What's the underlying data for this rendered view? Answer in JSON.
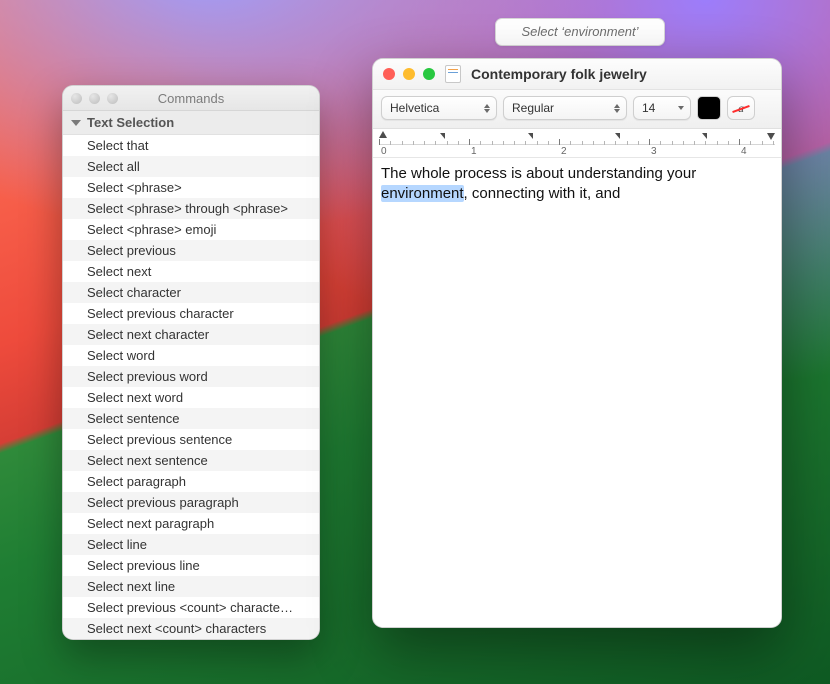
{
  "tooltip": {
    "text": "Select ‘environment’"
  },
  "commands_panel": {
    "title": "Commands",
    "section_label": "Text Selection",
    "items": [
      "Select that",
      "Select all",
      "Select <phrase>",
      "Select <phrase> through <phrase>",
      "Select <phrase> emoji",
      "Select previous",
      "Select next",
      "Select character",
      "Select previous character",
      "Select next character",
      "Select word",
      "Select previous word",
      "Select next word",
      "Select sentence",
      "Select previous sentence",
      "Select next sentence",
      "Select paragraph",
      "Select previous paragraph",
      "Select next paragraph",
      "Select line",
      "Select previous line",
      "Select next line",
      "Select previous <count> characte…",
      "Select next <count> characters"
    ]
  },
  "editor": {
    "title": "Contemporary folk jewelry",
    "toolbar": {
      "font": "Helvetica",
      "style": "Regular",
      "size": "14",
      "text_color": "#000000",
      "accent_letter": "a"
    },
    "ruler": {
      "major_labels": [
        "0",
        "1",
        "2",
        "3",
        "4"
      ]
    },
    "body": {
      "pre": "The whole process is about understanding your ",
      "highlight": "environment",
      "post": ", connecting with it, and"
    }
  }
}
